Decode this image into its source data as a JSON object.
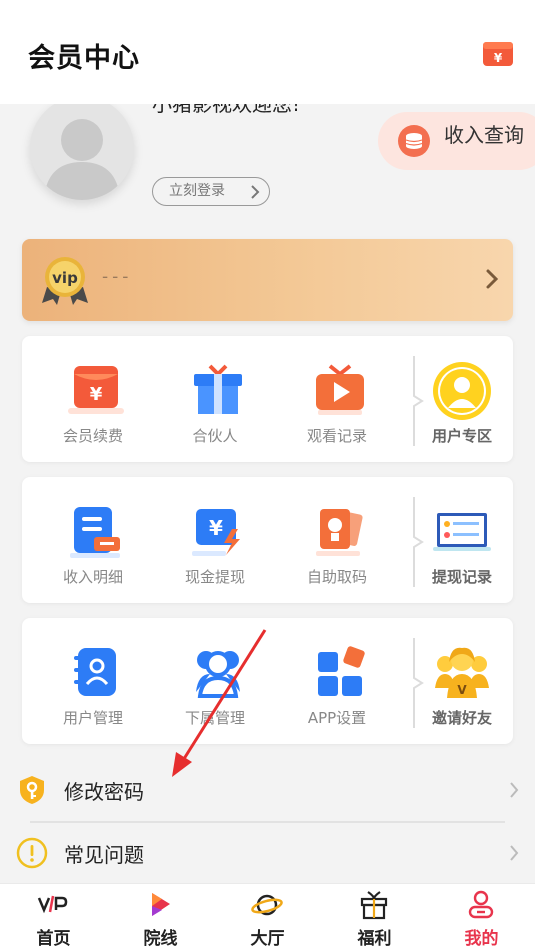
{
  "header": {
    "title": "会员中心",
    "wallet_icon": "wallet-icon"
  },
  "profile": {
    "welcome": "小猪影视欢迎您!",
    "login_label": "立刻登录",
    "income_query_label": "收入查询"
  },
  "vip": {
    "badge_text": "vip",
    "status": "---"
  },
  "grid1": {
    "items": [
      {
        "label": "会员续费",
        "icon": "renew-icon"
      },
      {
        "label": "合伙人",
        "icon": "gift-icon"
      },
      {
        "label": "观看记录",
        "icon": "tv-icon"
      }
    ],
    "special": {
      "label": "用户专区",
      "icon": "user-zone-icon"
    }
  },
  "grid2": {
    "items": [
      {
        "label": "收入明细",
        "icon": "income-detail-icon"
      },
      {
        "label": "现金提现",
        "icon": "cash-withdraw-icon"
      },
      {
        "label": "自助取码",
        "icon": "self-code-icon"
      }
    ],
    "special": {
      "label": "提现记录",
      "icon": "withdraw-record-icon"
    }
  },
  "grid3": {
    "items": [
      {
        "label": "用户管理",
        "icon": "contacts-icon"
      },
      {
        "label": "下属管理",
        "icon": "team-icon"
      },
      {
        "label": "APP设置",
        "icon": "app-settings-icon"
      }
    ],
    "special": {
      "label": "邀请好友",
      "icon": "invite-friends-icon"
    }
  },
  "list": [
    {
      "label": "修改密码",
      "icon": "shield-key-icon"
    },
    {
      "label": "常见问题",
      "icon": "exclamation-icon"
    }
  ],
  "nav": [
    {
      "label": "首页",
      "icon": "vip-home-icon"
    },
    {
      "label": "院线",
      "icon": "play-icon"
    },
    {
      "label": "大厅",
      "icon": "planet-icon"
    },
    {
      "label": "福利",
      "icon": "gift-box-icon"
    },
    {
      "label": "我的",
      "icon": "user-icon"
    }
  ],
  "colors": {
    "accent_red": "#e8344c",
    "orange": "#f36f50",
    "blue": "#2d7cf6",
    "vip_gold": "#f3c895"
  }
}
